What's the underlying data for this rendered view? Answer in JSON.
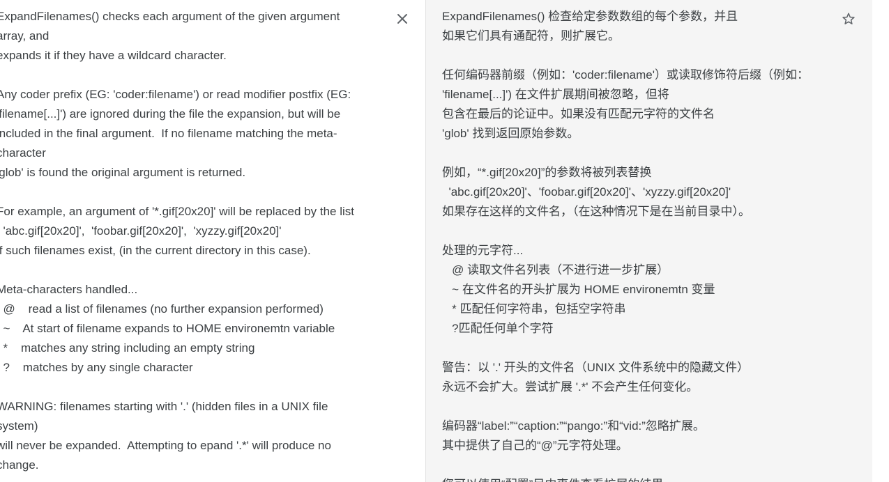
{
  "source": {
    "lines": [
      "ExpandFilenames() checks each argument of the given argument",
      "array, and",
      "expands it if they have a wildcard character.",
      "",
      "Any coder prefix (EG: 'coder:filename') or read modifier postfix (EG:",
      "'filename[...]') are ignored during the file the expansion, but will be",
      "included in the final argument.  If no filename matching the meta-",
      "character",
      "'glob' is found the original argument is returned.",
      "",
      "For example, an argument of '*.gif[20x20]' will be replaced by the list",
      "  'abc.gif[20x20]',  'foobar.gif[20x20]',  'xyzzy.gif[20x20]'",
      "if such filenames exist, (in the current directory in this case).",
      "",
      "Meta-characters handled...",
      "  @    read a list of filenames (no further expansion performed)",
      "  ~    At start of filename expands to HOME environemtn variable",
      "  *    matches any string including an empty string",
      "  ?    matches by any single character",
      "",
      "WARNING: filenames starting with '.' (hidden files in a UNIX file",
      "system)",
      "will never be expanded.  Attempting to epand '.*' will produce no",
      "change."
    ],
    "close_icon": "close-icon"
  },
  "target": {
    "lines": [
      "ExpandFilenames() 检查给定参数数组的每个参数，并且",
      "如果它们具有通配符，则扩展它。",
      "",
      "任何编码器前缀（例如：'coder:filename'）或读取修饰符后缀（例如：",
      "'filename[...]') 在文件扩展期间被忽略，但将",
      "包含在最后的论证中。如果没有匹配元字符的文件名",
      "'glob' 找到返回原始参数。",
      "",
      "例如，“*.gif[20x20]”的参数将被列表替换",
      "  'abc.gif[20x20]'、'foobar.gif[20x20]'、'xyzzy.gif[20x20]'",
      "如果存在这样的文件名，（在这种情况下是在当前目录中）。",
      "",
      "处理的元字符...",
      "   @ 读取文件名列表（不进行进一步扩展）",
      "   ~ 在文件名的开头扩展为 HOME environemtn 变量",
      "   * 匹配任何字符串，包括空字符串",
      "   ?匹配任何单个字符",
      "",
      "警告：以 '.' 开头的文件名（UNIX 文件系统中的隐藏文件）",
      "永远不会扩大。尝试扩展 '.*' 不会产生任何变化。",
      "",
      "编码器“label:”“caption:”“pango:”和“vid:”忽略扩展。",
      "其中提供了自己的“@”元字符处理。",
      "",
      "您可以使用“配置”目内事件查看扩展的结果"
    ],
    "star_icon": "star-outline-icon"
  },
  "colors": {
    "text": "#3c4043",
    "target_bg": "#f5f5f5",
    "icon": "#5f6368"
  }
}
